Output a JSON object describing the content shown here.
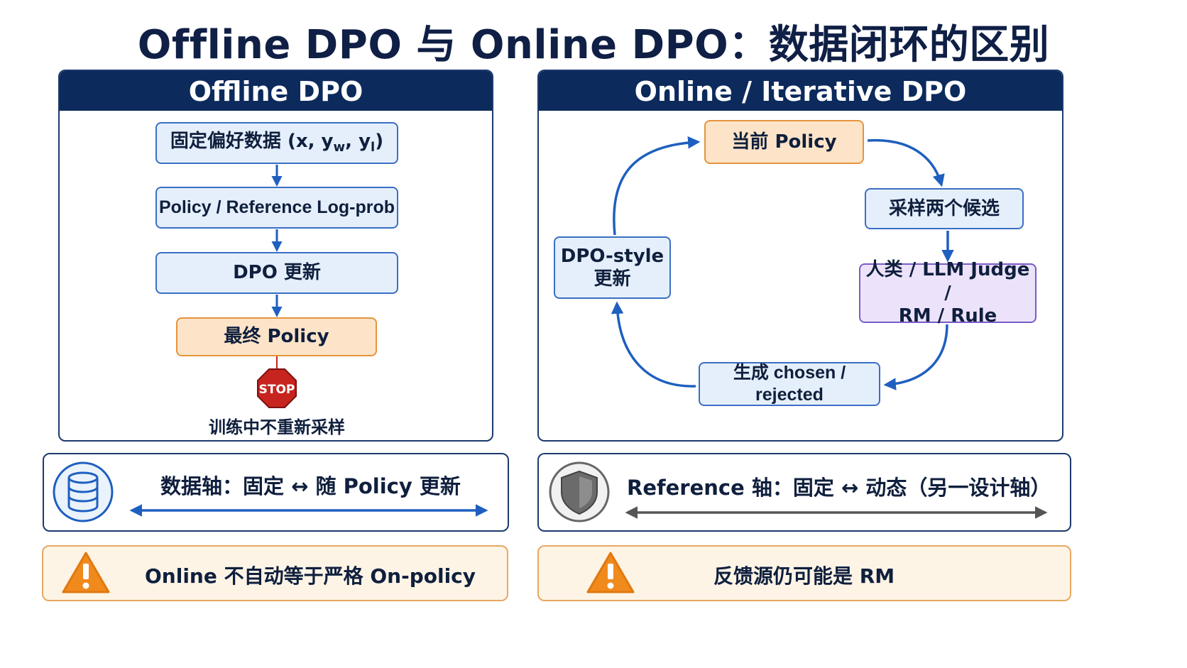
{
  "title": "Offline DPO 与 Online DPO：数据闭环的区别",
  "offline": {
    "header": "Offline DPO",
    "step1_prefix": "固定偏好数据 (x, y",
    "step1_sub_w": "w",
    "step1_mid": ", y",
    "step1_sub_l": "l",
    "step1_suffix": ")",
    "step2": "Policy / Reference Log-prob",
    "step3": "DPO 更新",
    "step4": "最终 Policy",
    "stop_sign": "STOP",
    "stop_label": "训练中不重新采样"
  },
  "online": {
    "header": "Online / Iterative DPO",
    "current_policy": "当前 Policy",
    "sample": "采样两个候选",
    "judge_line1": "人类 / LLM Judge /",
    "judge_line2": "RM / Rule",
    "generate": "生成 chosen / rejected",
    "update_line1": "DPO-style",
    "update_line2": "更新"
  },
  "axis_bars": {
    "data_axis": "数据轴：固定 ↔ 随 Policy 更新",
    "reference_axis": "Reference 轴：固定 ↔ 动态（另一设计轴）"
  },
  "warnings": {
    "left": "Online 不自动等于严格 On-policy",
    "right": "反馈源仍可能是 RM"
  },
  "icons": {
    "database": "database-icon",
    "shield": "shield-icon",
    "warning": "warning-icon",
    "stop": "stop-sign-icon"
  },
  "colors": {
    "navy": "#0c2a5c",
    "blue_arrow": "#1f5fbf",
    "box_blue": "#e5effb",
    "box_orange": "#fde4c8",
    "box_purple": "#ece3fb",
    "warning_orange": "#f08a1c",
    "stop_red": "#c8241f"
  }
}
